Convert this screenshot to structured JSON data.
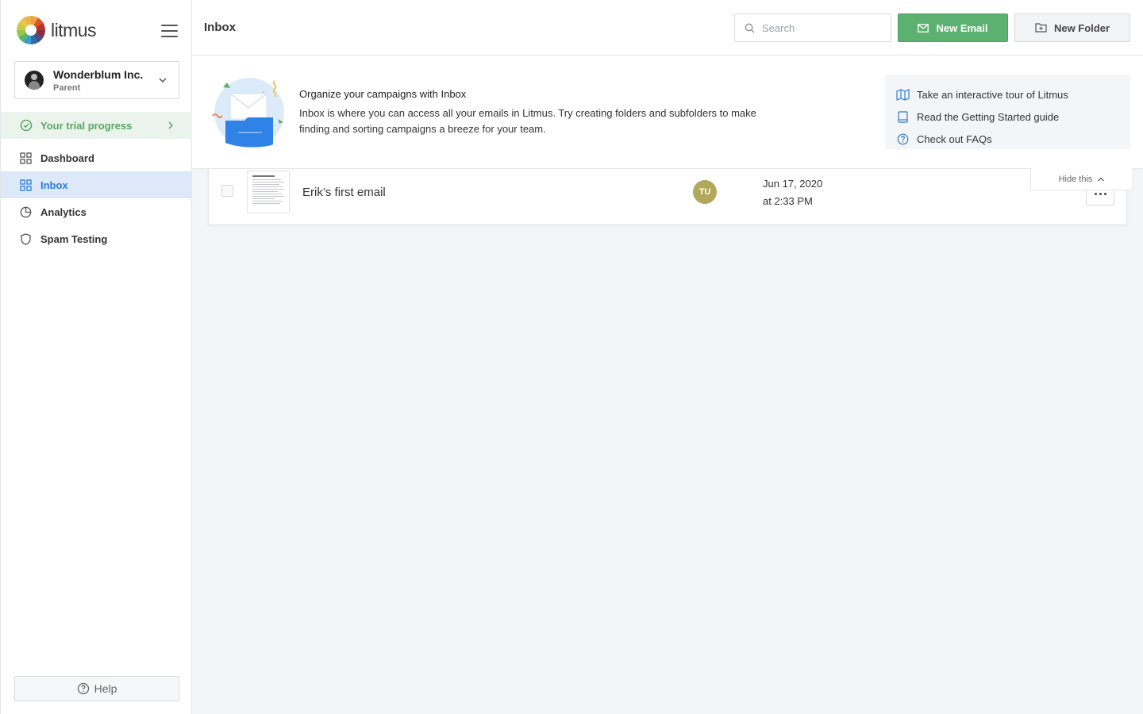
{
  "app": {
    "logo_text": "litmus"
  },
  "account": {
    "name": "Wonderblum Inc.",
    "role": "Parent"
  },
  "trial": {
    "label": "Your trial progress"
  },
  "nav": {
    "items": [
      {
        "label": "Dashboard",
        "icon": "grid-icon",
        "active": false
      },
      {
        "label": "Inbox",
        "icon": "grid-icon",
        "active": true
      },
      {
        "label": "Analytics",
        "icon": "pie-chart-icon",
        "active": false
      },
      {
        "label": "Spam Testing",
        "icon": "shield-icon",
        "active": false
      }
    ]
  },
  "help": {
    "label": "Help"
  },
  "header": {
    "title": "Inbox",
    "search_placeholder": "Search",
    "new_email_label": "New Email",
    "new_folder_label": "New Folder"
  },
  "banner": {
    "title": "Organize your campaigns with Inbox",
    "description": "Inbox is where you can access all your emails in Litmus. Try creating folders and subfolders to make finding and sorting campaigns a breeze for your team.",
    "links": [
      {
        "label": "Take an interactive tour of Litmus",
        "icon": "map-icon"
      },
      {
        "label": "Read the Getting Started guide",
        "icon": "book-icon"
      },
      {
        "label": "Check out FAQs",
        "icon": "question-circle-icon"
      }
    ],
    "hide_label": "Hide this"
  },
  "emails": [
    {
      "title": "Erik’s first email",
      "owner_initials": "TU",
      "date": "Jun 17, 2020",
      "time": "at 2:33 PM"
    }
  ],
  "colors": {
    "brand_green": "#5cb070",
    "active_blue": "#2c7ad6",
    "active_bg": "#dde9f8",
    "trial_green": "#5aa564",
    "owner_avatar": "#b2a85c"
  }
}
